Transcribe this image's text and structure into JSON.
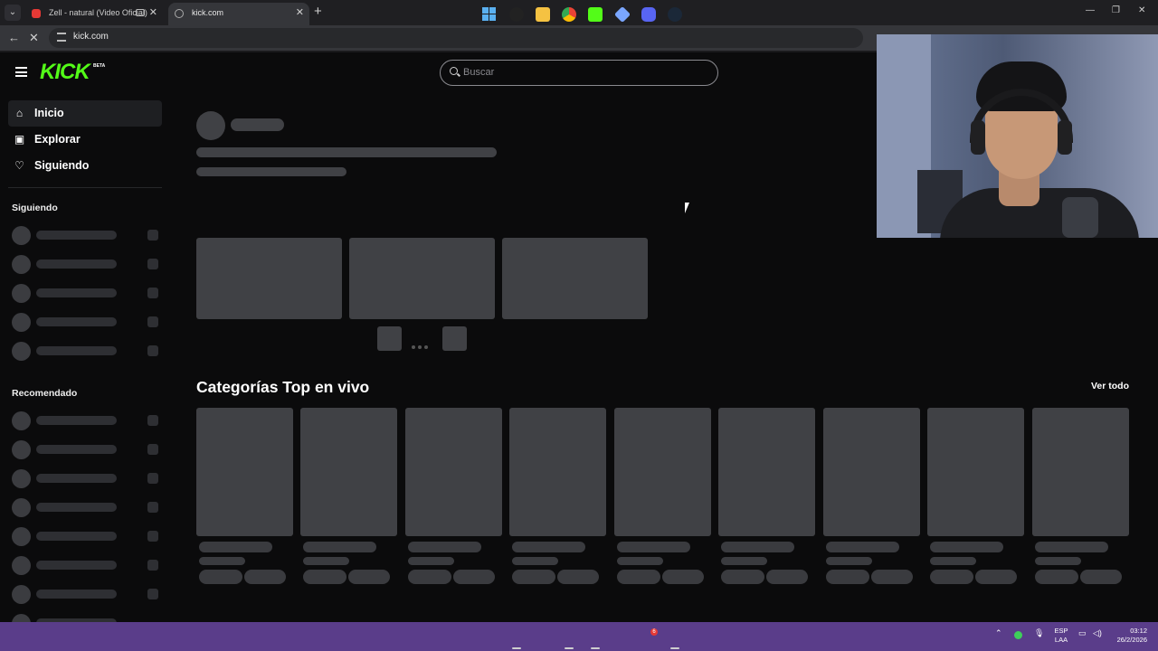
{
  "browser": {
    "tabs": [
      {
        "title": "Zell - natural (Video Oficial)",
        "favicon": "youtube-icon"
      },
      {
        "title": "kick.com",
        "favicon": "globe-icon"
      }
    ],
    "address": "kick.com"
  },
  "site": {
    "logo": "KICK",
    "logo_badge": "BETA",
    "search_placeholder": "Buscar",
    "nav": [
      {
        "label": "Inicio",
        "icon": "home-icon",
        "active": true
      },
      {
        "label": "Explorar",
        "icon": "compass-icon"
      },
      {
        "label": "Siguiendo",
        "icon": "heart-icon"
      }
    ],
    "following_heading": "Siguiendo",
    "recommended_heading": "Recomendado",
    "categories_title": "Categorías Top en vivo",
    "see_all": "Ver todo"
  },
  "taskbar": {
    "lang_1": "ESP",
    "lang_2": "LAA",
    "time": "03:12",
    "date": "26/2/2026",
    "discord_badge": "6"
  }
}
